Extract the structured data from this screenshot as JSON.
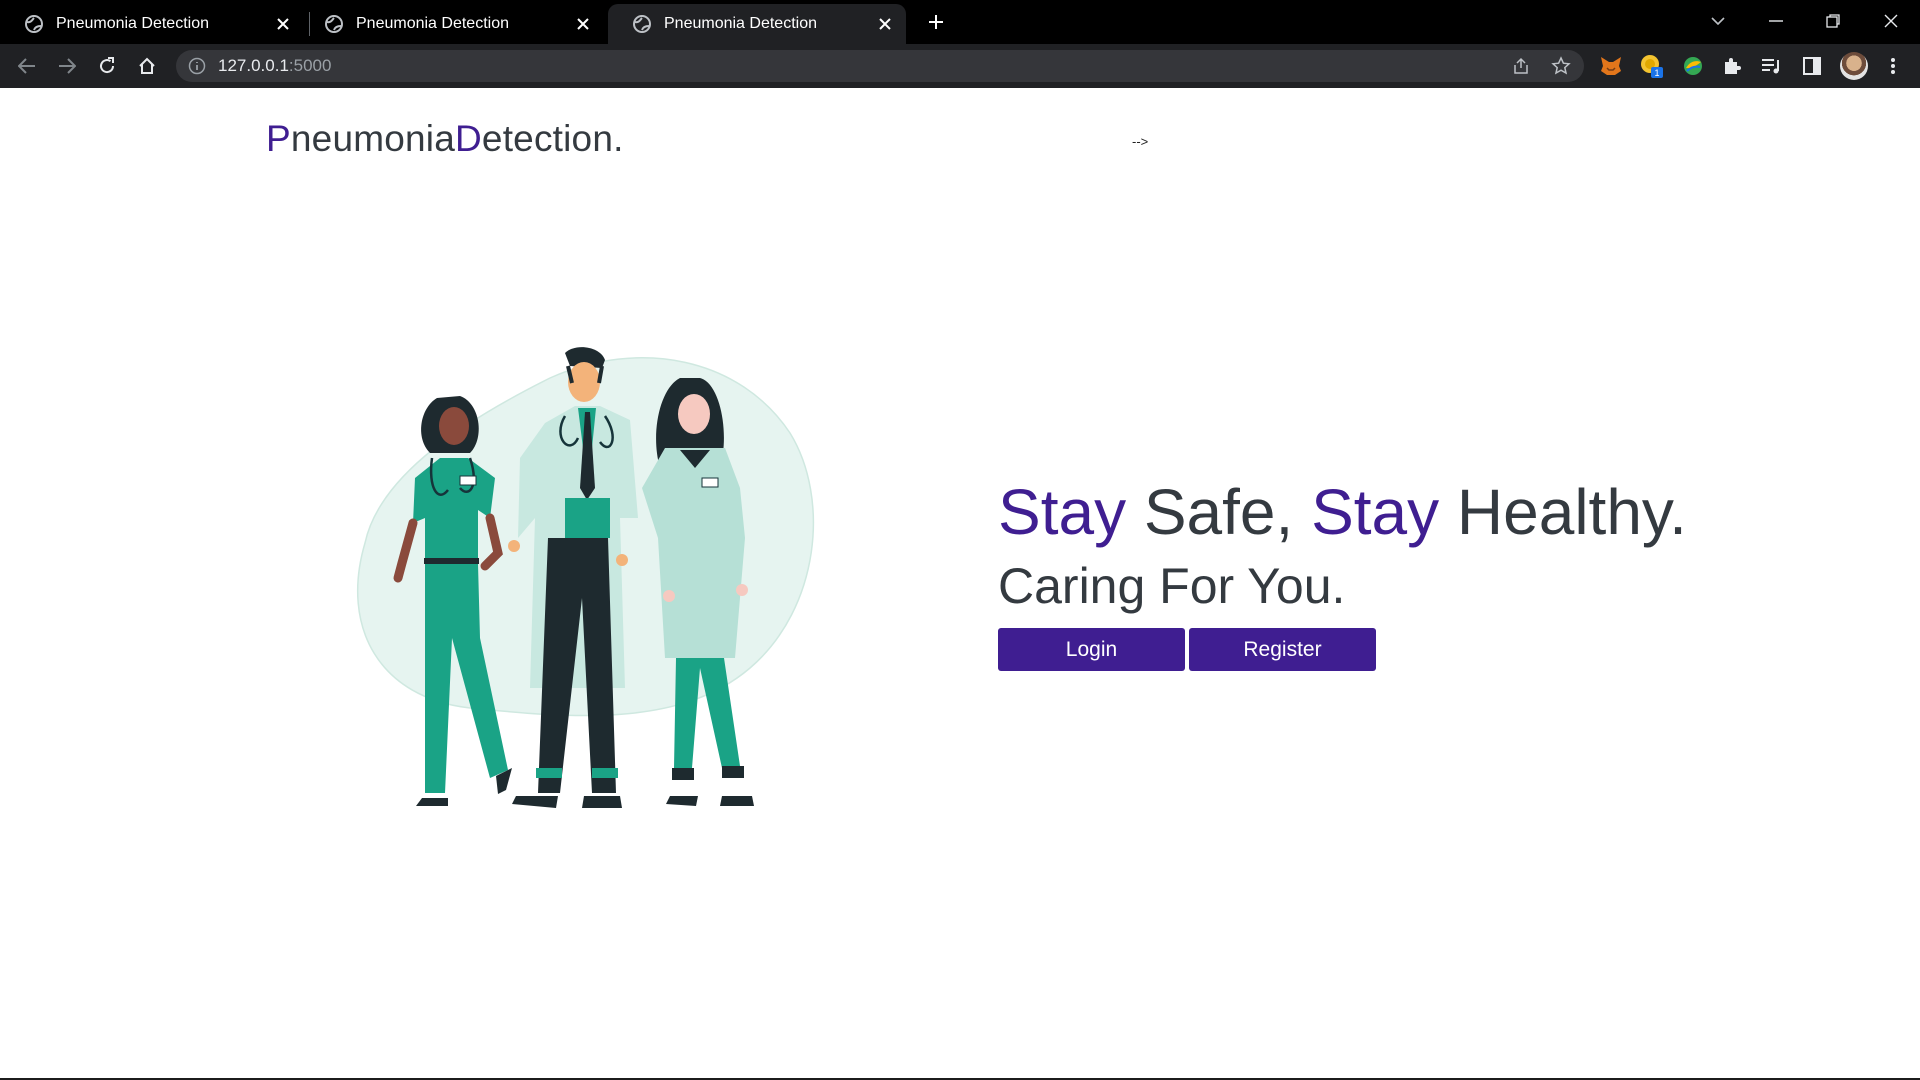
{
  "browser": {
    "tabs": [
      {
        "title": "Pneumonia Detection",
        "active": false
      },
      {
        "title": "Pneumonia Detection",
        "active": false
      },
      {
        "title": "Pneumonia Detection",
        "active": true
      }
    ],
    "url_host": "127.0.0.1",
    "url_port": ":5000",
    "icons": [
      "globe-icon",
      "close-icon",
      "plus-icon",
      "chevron-down-icon",
      "minimize-icon",
      "restore-icon",
      "window-close-icon",
      "back-icon",
      "forward-icon",
      "reload-icon",
      "home-icon",
      "info-icon",
      "share-icon",
      "star-icon",
      "fox-extension-icon",
      "coin-extension-icon",
      "leaf-extension-icon",
      "puzzle-icon",
      "media-icon",
      "sidepanel-icon",
      "avatar",
      "menu-icon"
    ],
    "extension_badge": "1"
  },
  "page": {
    "logo": {
      "p": "P",
      "neumonia": "neumonia",
      "d": "D",
      "etection": "etection."
    },
    "stray_text": "-->",
    "hero": {
      "stay1": "Stay",
      "safe": " Safe, ",
      "stay2": "Stay",
      "healthy": " Healthy.",
      "subline": "Caring For You."
    },
    "buttons": {
      "login": "Login",
      "register": "Register"
    }
  },
  "colors": {
    "accent": "#3f1e91",
    "text": "#343a40",
    "scrub": "#1aa386",
    "blob": "#e6f4f0"
  }
}
